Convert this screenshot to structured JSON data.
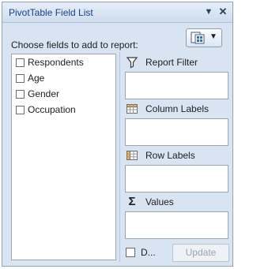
{
  "panel": {
    "title": "PivotTable Field List",
    "dropdown_icon": "chevron-down-icon",
    "close_icon": "close-icon"
  },
  "choose_label": "Choose fields to add to report:",
  "layout_button": {
    "icon": "field-list-layout-icon"
  },
  "fields": [
    {
      "label": "Respondents",
      "checked": false
    },
    {
      "label": "Age",
      "checked": false
    },
    {
      "label": "Gender",
      "checked": false
    },
    {
      "label": "Occupation",
      "checked": false
    }
  ],
  "areas": {
    "report_filter": {
      "label": "Report Filter",
      "icon": "filter-icon"
    },
    "column_labels": {
      "label": "Column Labels",
      "icon": "column-labels-icon"
    },
    "row_labels": {
      "label": "Row Labels",
      "icon": "row-labels-icon"
    },
    "values": {
      "label": "Values",
      "icon": "sigma-icon"
    }
  },
  "defer": {
    "label": "D...",
    "checked": false
  },
  "update_label": "Update",
  "colors": {
    "panel_bg": "#d9e4f2",
    "title_text": "#15428b",
    "border": "#9aa6b6"
  }
}
